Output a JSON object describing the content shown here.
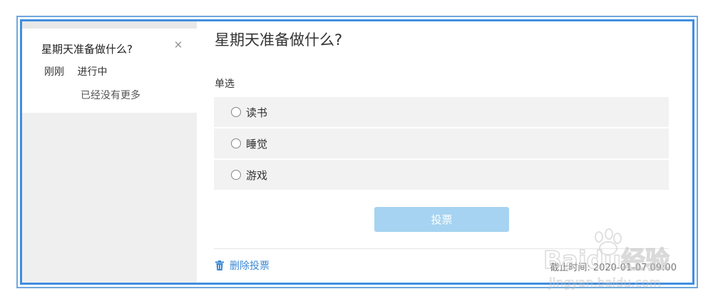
{
  "left_list": {
    "item": {
      "title": "星期天准备做什么?",
      "time": "刚刚",
      "status": "进行中"
    },
    "close_icon": "close-icon",
    "no_more": "已经没有更多"
  },
  "vote": {
    "title": "星期天准备做什么?",
    "type": "单选",
    "options": [
      {
        "label": "读书"
      },
      {
        "label": "睡觉"
      },
      {
        "label": "游戏"
      }
    ],
    "submit_label": "投票",
    "delete_label": "删除投票",
    "deadline": "截止时间: 2020-01-07 09:00"
  },
  "colors": {
    "frame_outer": "#6ea8dc",
    "frame_inner": "#3f8ee0",
    "button": "#a6d3f1",
    "link": "#3b89d6"
  },
  "watermark": {
    "brand": "Baidu经验",
    "url": "jingyan.baidu.com"
  }
}
